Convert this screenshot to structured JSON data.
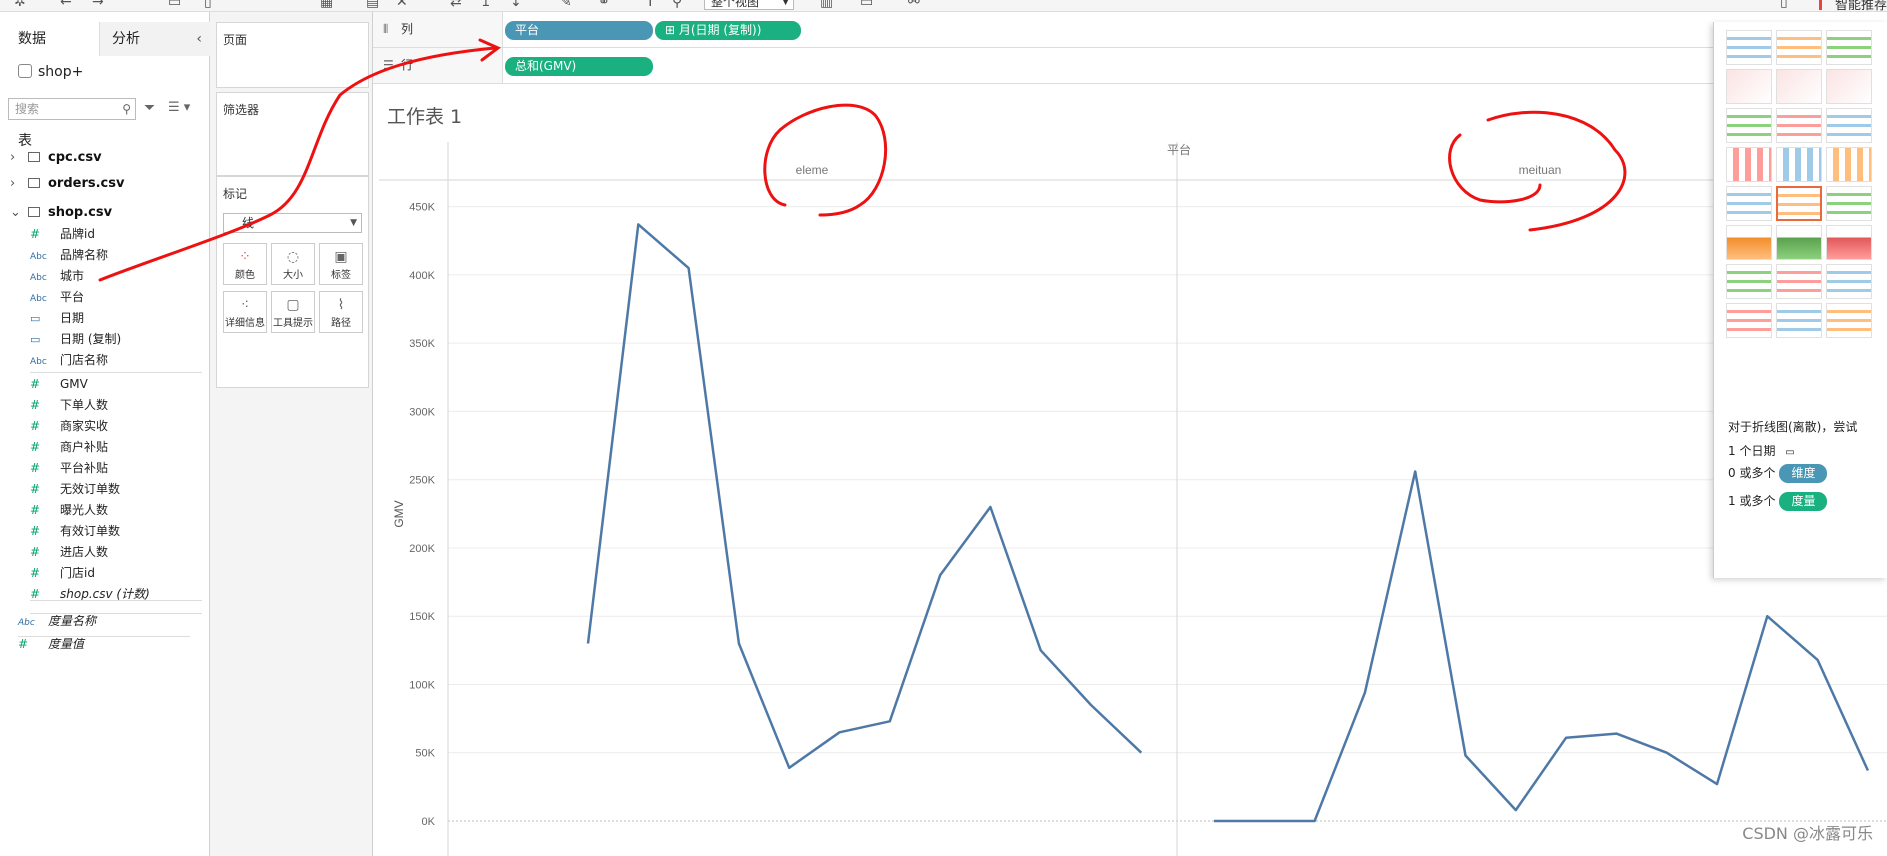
{
  "toolbar": {
    "view_select": "整个视图",
    "smart_tab": "智能推荐"
  },
  "data_pane": {
    "tab_data": "数据",
    "tab_analysis": "分析",
    "datasource": "shop+",
    "search_placeholder": "搜索",
    "tables_label": "表",
    "tables": [
      {
        "name": "cpc.csv"
      },
      {
        "name": "orders.csv"
      },
      {
        "name": "shop.csv"
      }
    ],
    "fields": [
      {
        "type": "#",
        "name": "品牌id"
      },
      {
        "type": "Abc",
        "name": "品牌名称"
      },
      {
        "type": "Abc",
        "name": "城市"
      },
      {
        "type": "Abc",
        "name": "平台"
      },
      {
        "type": "date",
        "name": "日期"
      },
      {
        "type": "date",
        "name": "日期 (复制)"
      },
      {
        "type": "Abc",
        "name": "门店名称"
      },
      {
        "type": "#",
        "name": "GMV"
      },
      {
        "type": "#",
        "name": "下单人数"
      },
      {
        "type": "#",
        "name": "商家实收"
      },
      {
        "type": "#",
        "name": "商户补贴"
      },
      {
        "type": "#",
        "name": "平台补贴"
      },
      {
        "type": "#",
        "name": "无效订单数"
      },
      {
        "type": "#",
        "name": "曝光人数"
      },
      {
        "type": "#",
        "name": "有效订单数"
      },
      {
        "type": "#",
        "name": "进店人数"
      },
      {
        "type": "#",
        "name": "门店id"
      },
      {
        "type": "#",
        "name": "shop.csv (计数)"
      }
    ],
    "measure_names": "度量名称",
    "measure_values": "度量值"
  },
  "shelves": {
    "pages": "页面",
    "filters": "筛选器",
    "marks": "标记",
    "mark_type": "线",
    "mark_buttons": [
      "颜色",
      "大小",
      "标签",
      "详细信息",
      "工具提示",
      "路径"
    ],
    "columns_label": "列",
    "rows_label": "行",
    "columns_pills": [
      "平台",
      "月(日期 (复制))"
    ],
    "rows_pills": [
      "总和(GMV)"
    ]
  },
  "sheet": {
    "title": "工作表 1"
  },
  "chart_data": {
    "type": "line",
    "header": "平台",
    "ylabel": "GMV",
    "yticks": [
      "0K",
      "50K",
      "100K",
      "150K",
      "200K",
      "250K",
      "300K",
      "350K",
      "400K",
      "450K"
    ],
    "ylim": [
      0,
      460000
    ],
    "panels": [
      {
        "name": "eleme",
        "values": [
          130000,
          437000,
          405000,
          130000,
          39000,
          65000,
          73000,
          180000,
          230000,
          125000,
          85000,
          50000
        ]
      },
      {
        "name": "meituan",
        "values": [
          0,
          0,
          0,
          94000,
          256000,
          48000,
          8000,
          61000,
          64000,
          50000,
          27000,
          150000,
          118000,
          37000
        ]
      }
    ]
  },
  "showme": {
    "hint_title": "对于折线图(离散)，尝试",
    "hint_date": "1 个日期",
    "hint_dim_prefix": "0 或多个",
    "hint_dim_tag": "维度",
    "hint_meas_prefix": "1 或多个",
    "hint_meas_tag": "度量"
  },
  "watermark": "CSDN @冰露可乐"
}
